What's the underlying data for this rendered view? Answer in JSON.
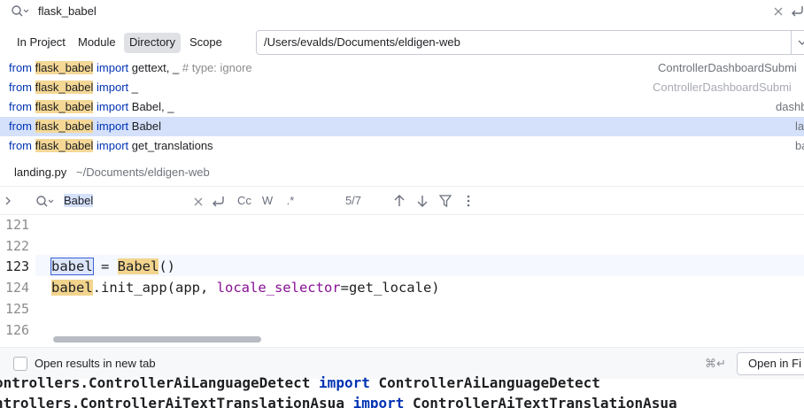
{
  "search": {
    "query": "flask_babel"
  },
  "scope_tabs": [
    {
      "label": "In Project",
      "active": false
    },
    {
      "label": "Module",
      "active": false
    },
    {
      "label": "Directory",
      "active": true
    },
    {
      "label": "Scope",
      "active": false
    }
  ],
  "directory": "/Users/evalds/Documents/eldigen-web",
  "results": [
    {
      "kw1": "from",
      "mod": "flask_babel",
      "kw2": "import",
      "rest": " gettext, _ ",
      "comment": "# type: ignore",
      "location": "ControllerDashboardSubmi"
    },
    {
      "kw1": "from",
      "mod": "flask_babel",
      "kw2": "import",
      "rest": " _",
      "comment": "",
      "location": "ControllerDashboardSubmi"
    },
    {
      "kw1": "from",
      "mod": "flask_babel",
      "kw2": "import",
      "rest": " Babel, _",
      "comment": "",
      "location": "dashb"
    },
    {
      "kw1": "from",
      "mod": "flask_babel",
      "kw2": "import",
      "rest": " Babel",
      "comment": "",
      "location": "la"
    },
    {
      "kw1": "from",
      "mod": "flask_babel",
      "kw2": "import",
      "rest": " get_translations",
      "comment": "",
      "location": "ba"
    }
  ],
  "preview": {
    "file": "landing.py",
    "path": "~/Documents/eldigen-web"
  },
  "find": {
    "term": "Babel",
    "match_count": "5/7",
    "case_label": "Cc",
    "word_label": "W",
    "regex_label": ".*"
  },
  "editor": {
    "line_numbers": [
      "121",
      "122",
      "123",
      "124",
      "125",
      "126"
    ],
    "line123": {
      "var": "babel",
      "op": " = ",
      "cls": "Babel",
      "tail": "()"
    },
    "line124": {
      "var": "babel",
      "call": ".init_app(app, ",
      "param": "locale_selector",
      "tail": "=get_locale)"
    }
  },
  "footer": {
    "checkbox_label": "Open results in new tab",
    "shortcut": "⌘↵",
    "open_button": "Open in Fi"
  },
  "background": {
    "line1": {
      "a": "ontrollers.ControllerAiLanguageDetect ",
      "kw": "import",
      "b": " ControllerAiLanguageDetect"
    },
    "line2": {
      "a": "ntrollers.ControllerAiTextTranslationAsua ",
      "kw": "import",
      "b": " ControllerAiTextTranslationAsua"
    }
  }
}
